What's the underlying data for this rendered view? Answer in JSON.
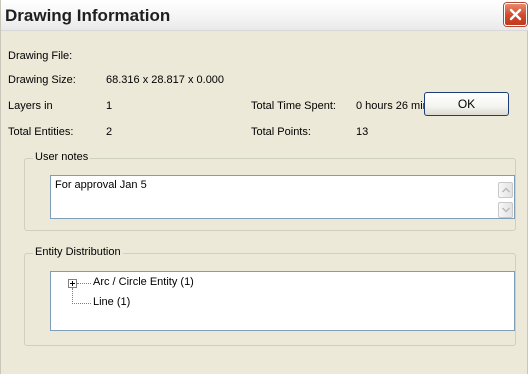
{
  "window": {
    "title": "Drawing Information",
    "close_icon": "close-icon"
  },
  "info": {
    "drawing_file_label": "Drawing File:",
    "drawing_file_value": "",
    "drawing_size_label": "Drawing Size:",
    "drawing_size_value": "68.316 x 28.817 x 0.000",
    "layers_label": "Layers in",
    "layers_value": "1",
    "total_entities_label": "Total Entities:",
    "total_entities_value": "2",
    "total_time_label": "Total Time Spent:",
    "total_time_value": "0 hours 26 minutes",
    "total_points_label": "Total Points:",
    "total_points_value": "13"
  },
  "ok_button": {
    "label": "OK"
  },
  "user_notes": {
    "title": "User notes",
    "text": "For approval Jan 5"
  },
  "entity_distribution": {
    "title": "Entity Distribution",
    "items": [
      {
        "label": "Arc / Circle Entity  (1)",
        "expandable": true
      },
      {
        "label": "Line  (1)",
        "expandable": false
      }
    ]
  },
  "colors": {
    "dialog_bg": "#ece9d8",
    "close_button": "#d1482a",
    "field_border": "#7f9db9"
  }
}
